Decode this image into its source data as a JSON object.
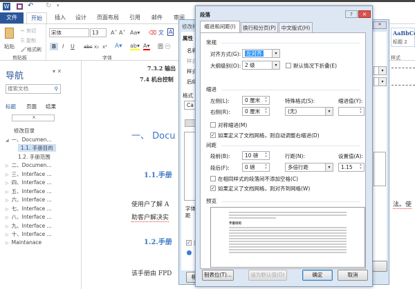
{
  "qat": {
    "icons": [
      "word-logo-icon",
      "save-icon",
      "undo-icon",
      "redo-icon",
      "customize-icon"
    ]
  },
  "ribbon_tabs": [
    "文件",
    "开始",
    "插入",
    "设计",
    "页面布局",
    "引用",
    "邮件",
    "审阅"
  ],
  "clipboard": {
    "paste": "粘贴",
    "cut": "剪切",
    "copy": "复制",
    "format_painter": "格式刷",
    "group": "剪贴板"
  },
  "font": {
    "name": "宋体",
    "size": "13",
    "group": "字体",
    "bold": "B",
    "italic": "I",
    "underline": "U",
    "strike": "abc",
    "sub": "x₂",
    "sup": "x²"
  },
  "styles": {
    "sample": "AaBbCc",
    "name": "标题 2",
    "group": "样式"
  },
  "nav": {
    "title": "导航",
    "search_placeholder": "搜索文档",
    "tabs": [
      "标题",
      "页面",
      "结果"
    ],
    "items": [
      {
        "label": "修改目录",
        "level": 0
      },
      {
        "label": "一、Documen...",
        "level": 0,
        "expanded": true
      },
      {
        "label": "1.1. 手册目的",
        "level": 1,
        "selected": true
      },
      {
        "label": "1.2. 手册范围",
        "level": 1
      },
      {
        "label": "二、Documen...",
        "level": 0
      },
      {
        "label": "三、Interface ...",
        "level": 0
      },
      {
        "label": "四、Interface ...",
        "level": 0
      },
      {
        "label": "五、Interface ...",
        "level": 0
      },
      {
        "label": "六、Interface ...",
        "level": 0
      },
      {
        "label": "七、Interface ...",
        "level": 0
      },
      {
        "label": "八、Interface ...",
        "level": 0
      },
      {
        "label": "九、Interface ...",
        "level": 0
      },
      {
        "label": "十、Interface ...",
        "level": 0
      },
      {
        "label": "Maintanace",
        "level": 0
      }
    ]
  },
  "doc": {
    "toc1": "7.3.2 输出",
    "toc2": "7.4 机台控制",
    "h1": "一、 Docu",
    "h2a": "1.1.手册",
    "p1a": "使用户了解 A",
    "p1b": "助客户解决实",
    "p1right": "法。使",
    "h2b": "1.2.手册",
    "p2": "该手册由 FPD"
  },
  "modify_dialog": {
    "title": "修改样",
    "props": "属性",
    "name": "名称",
    "type": "样式",
    "based": "样式",
    "next": "后续",
    "format": "格式",
    "font_value": "Ca",
    "desc": "字体\n距",
    "add": "添",
    "format_btn": "格式"
  },
  "dialog": {
    "title": "段落",
    "help": "?",
    "close": "×",
    "tabs": [
      "缩进和间距(I)",
      "换行和分页(P)",
      "中文版式(H)"
    ],
    "general": "常规",
    "align_label": "对齐方式(G):",
    "align_value": "左对齐",
    "outline_label": "大纲级别(O):",
    "outline_value": "2 级",
    "collapse_label": "默认情况下折叠(E)",
    "indent": "缩进",
    "left_label": "左侧(L):",
    "left_value": "0 厘米",
    "right_label": "右侧(R):",
    "right_value": "0 厘米",
    "special_label": "特殊格式(S):",
    "special_value": "(无)",
    "by_label": "缩进值(Y):",
    "by_value": "",
    "mirror_label": "对称缩进(M)",
    "mirror_checked": false,
    "auto_right_label": "如果定义了文档网格，则自动调整右缩进(D)",
    "auto_right_checked": true,
    "spacing": "间距",
    "before_label": "段前(B):",
    "before_value": "10 磅",
    "after_label": "段后(F):",
    "after_value": "0 磅",
    "line_label": "行距(N):",
    "line_value": "多倍行距",
    "at_label": "设置值(A):",
    "at_value": "1.15",
    "no_space_label": "在相同样式的段落间不添加空格(C)",
    "no_space_checked": false,
    "grid_label": "如果定义了文档网格，则对齐到网格(W)",
    "grid_checked": true,
    "preview": "预览",
    "preview_heading": "手册目的",
    "tabs_btn": "制表位(T)...",
    "default_btn": "设为默认值(D)",
    "ok_btn": "确定",
    "cancel_btn": "取消"
  }
}
